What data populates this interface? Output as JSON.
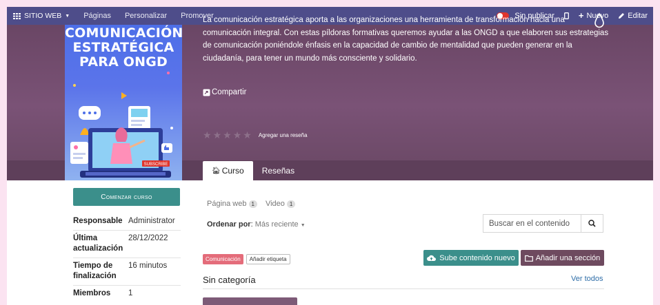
{
  "topbar": {
    "brand": "SITIO WEB",
    "menu": [
      "Páginas",
      "Personalizar",
      "Promover"
    ],
    "unpublished": "Sin publicar",
    "new": "Nuevo",
    "edit": "Editar"
  },
  "course": {
    "cover_title": "COMUNICACIÓN ESTRATÉGICA PARA ONGD",
    "cover_badge": "SUBSCRIBE",
    "description": "La comunicación estratégica aporta a las organizaciones una herramienta de transformación hacia una comunicación integral. Con estas píldoras formativas queremos ayudar a las ONGD a que elaboren sus estrategias de comunicación  poniéndole énfasis en la capacidad de cambio de mentalidad que pueden generar en la ciudadanía, para tener un mundo más consciente y solidario.",
    "share": "Compartir",
    "rating": 0,
    "add_review": "Agregar una reseña"
  },
  "tabs": [
    {
      "label": "Curso",
      "active": true
    },
    {
      "label": "Reseñas",
      "active": false
    }
  ],
  "sidebar": {
    "start_button": "Comenzar curso",
    "info": [
      {
        "key": "Responsable",
        "value": "Administrator"
      },
      {
        "key": "Última actualización",
        "value": "28/12/2022"
      },
      {
        "key": "Tiempo de finalización",
        "value": "16 minutos"
      },
      {
        "key": "Miembros",
        "value": "1"
      }
    ]
  },
  "content": {
    "filters": [
      {
        "label": "Página web",
        "count": "1"
      },
      {
        "label": "Video",
        "count": "1"
      }
    ],
    "order_label": "Ordenar por",
    "order_value": "Más reciente",
    "search_placeholder": "Buscar en el contenido",
    "tag": "Comunicación",
    "add_tag": "Añadir etiqueta",
    "upload_button": "Sube contenido nuevo",
    "add_section_button": "Añadir una sección",
    "section_title": "Sin categoría",
    "see_all": "Ver todos"
  },
  "colors": {
    "topbar": "#4e4d8a",
    "hero": "#7a5276",
    "teal": "#3b8f8b",
    "section_button": "#6e4a5f",
    "tag": "#e46c7a",
    "link": "#2f6ea8"
  }
}
